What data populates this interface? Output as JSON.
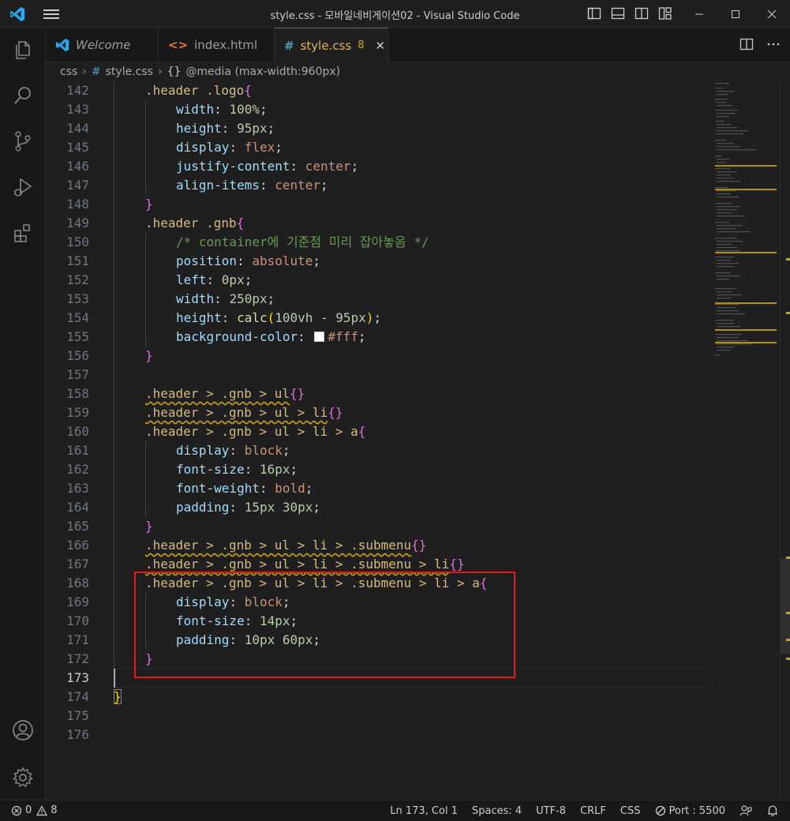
{
  "window": {
    "title": "style.css - 모바일네비게이션02 - Visual Studio Code"
  },
  "tabs": [
    {
      "label": "Welcome",
      "icon": "vscode-icon",
      "active": false
    },
    {
      "label": "index.html",
      "icon": "html-icon",
      "active": false
    },
    {
      "label": "style.css",
      "icon": "css-hash-icon",
      "active": true,
      "badge": "8"
    }
  ],
  "breadcrumb": {
    "folder": "css",
    "file": "style.css",
    "symbol": "@media (max-width:960px)"
  },
  "editor": {
    "current_line": 173,
    "line_numbers": [
      "142",
      "143",
      "144",
      "145",
      "146",
      "147",
      "148",
      "149",
      "150",
      "151",
      "152",
      "153",
      "154",
      "155",
      "156",
      "157",
      "158",
      "159",
      "160",
      "161",
      "162",
      "163",
      "164",
      "165",
      "166",
      "167",
      "168",
      "169",
      "170",
      "171",
      "172",
      "173",
      "174",
      "175",
      "176"
    ],
    "code": {
      "l142_sel": ".header .logo",
      "l142_br": "{",
      "l143_p": "width",
      "l143_v": "100%",
      "l144_p": "height",
      "l144_v": "95px",
      "l145_p": "display",
      "l145_v": "flex",
      "l146_p": "justify-content",
      "l146_v": "center",
      "l147_p": "align-items",
      "l147_v": "center",
      "l148_br": "}",
      "l149_sel": ".header .gnb",
      "l149_br": "{",
      "l150_c": "/* container에 기준점 미리 잡아놓음 */",
      "l151_p": "position",
      "l151_v": "absolute",
      "l152_p": "left",
      "l152_v": "0px",
      "l153_p": "width",
      "l153_v": "250px",
      "l154_p": "height",
      "l154_fn": "calc",
      "l154_v": "100vh - 95px",
      "l155_p": "background-color",
      "l155_v": "#fff",
      "l156_br": "}",
      "l158_sel": ".header > .gnb > ul",
      "l158_br": "{}",
      "l159_sel": ".header > .gnb > ul > li",
      "l159_br": "{}",
      "l160_sel": ".header > .gnb > ul > li > a",
      "l160_br": "{",
      "l161_p": "display",
      "l161_v": "block",
      "l162_p": "font-size",
      "l162_v": "16px",
      "l163_p": "font-weight",
      "l163_v": "bold",
      "l164_p": "padding",
      "l164_v": "15px 30px",
      "l165_br": "}",
      "l166_sel": ".header > .gnb > ul > li > .submenu",
      "l166_br": "{}",
      "l167_sel": ".header > .gnb > ul > li > .submenu > li",
      "l167_br": "{}",
      "l168_sel": ".header > .gnb > ul > li > .submenu > li > a",
      "l168_br": "{",
      "l169_p": "display",
      "l169_v": "block",
      "l170_p": "font-size",
      "l170_v": "14px",
      "l171_p": "padding",
      "l171_v": "10px 60px",
      "l172_br": "}",
      "l174_br": "}"
    }
  },
  "statusbar": {
    "errors": "0",
    "warnings": "8",
    "position": "Ln 173, Col 1",
    "spaces": "Spaces: 4",
    "encoding": "UTF-8",
    "eol": "CRLF",
    "language": "CSS",
    "port": "Port : 5500"
  },
  "colors": {
    "highlight_box": "#e01b1b",
    "accent": "#0078d4",
    "warning": "#cca700"
  }
}
